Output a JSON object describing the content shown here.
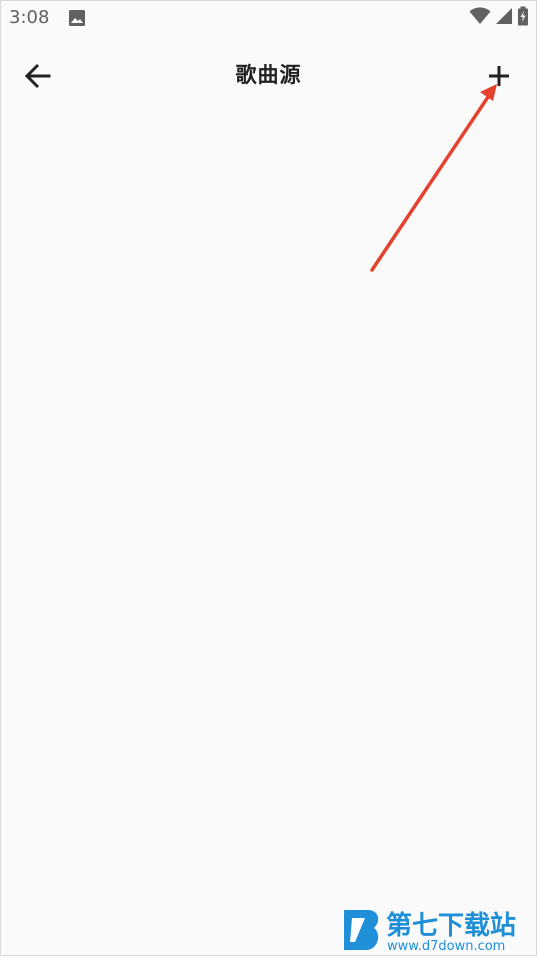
{
  "status_bar": {
    "time": "3:08",
    "icons": [
      "image-icon",
      "wifi-icon",
      "cellular-signal-icon",
      "battery-charging-icon"
    ]
  },
  "app_bar": {
    "title": "歌曲源",
    "back_icon": "arrow-left-icon",
    "add_icon": "plus-icon"
  },
  "content": {
    "items": []
  },
  "annotation": {
    "type": "arrow",
    "color": "#e4412f",
    "points_to": "add-button"
  },
  "watermark": {
    "name": "第七下载站",
    "url": "www.d7down.com"
  },
  "colors": {
    "background": "#fafafa",
    "title": "#202124",
    "icon": "#222222",
    "status": "#616161",
    "watermark_blue": "#1f8fd8"
  }
}
